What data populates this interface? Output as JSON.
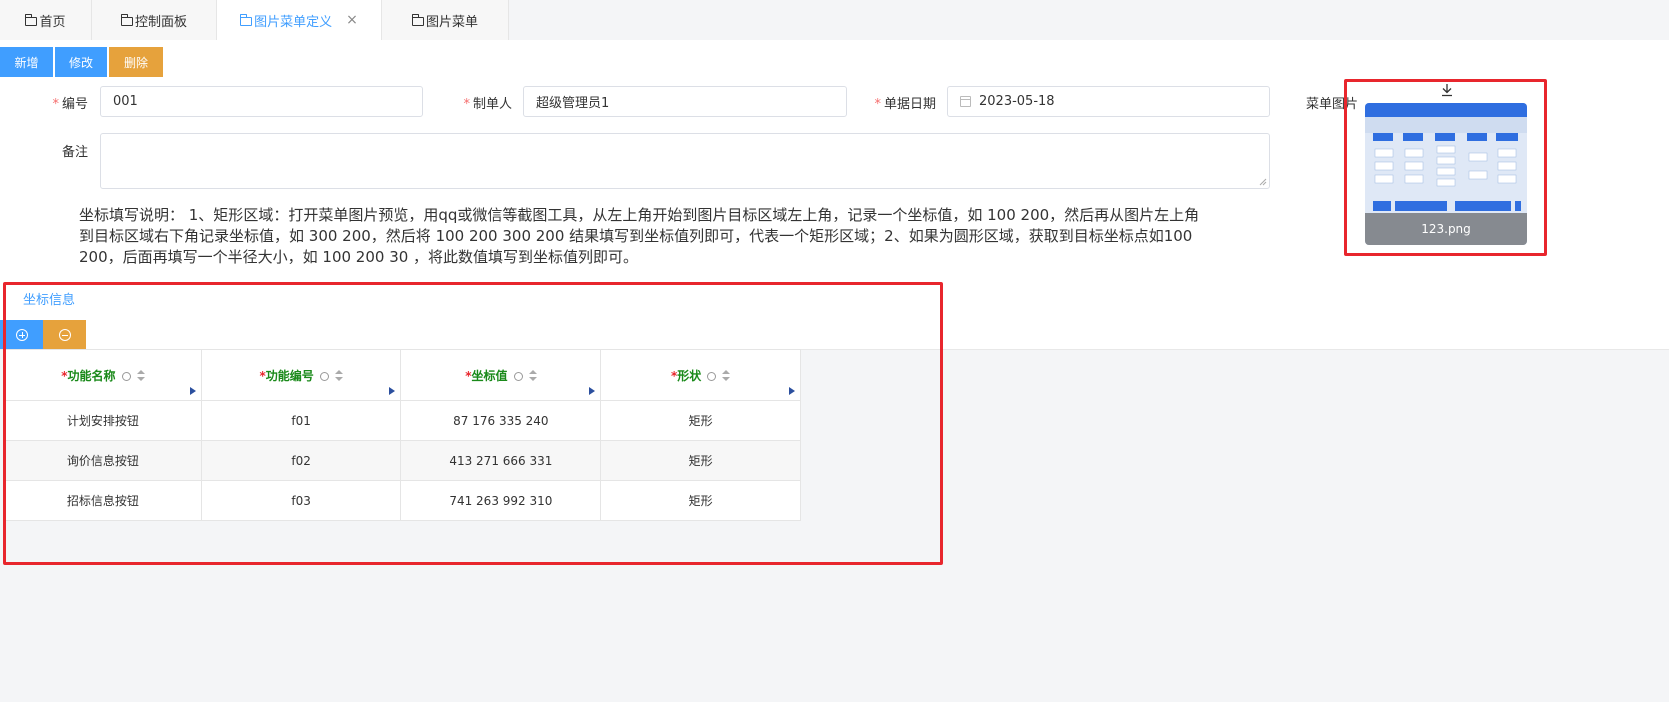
{
  "tabs": [
    {
      "label": "首页"
    },
    {
      "label": "控制面板"
    },
    {
      "label": "图片菜单定义",
      "close": "×"
    },
    {
      "label": "图片菜单"
    }
  ],
  "toolbar": {
    "add": "新增",
    "edit": "修改",
    "delete": "删除"
  },
  "form": {
    "code": {
      "label": "编号",
      "value": "001"
    },
    "creator": {
      "label": "制单人",
      "value": "超级管理员1"
    },
    "date": {
      "label": "单据日期",
      "value": "2023-05-18"
    },
    "image": {
      "label": "菜单图片",
      "filename": "123.png"
    },
    "remark": {
      "label": "备注",
      "value": ""
    }
  },
  "note_lines": [
    "坐标填写说明： 1、矩形区域：打开菜单图片预览，用qq或微信等截图工具，从左上角开始到图片目标区域左上角，记录一个坐标值，如 100 200，然后再从图片左上角",
    "到目标区域右下角记录坐标值，如 300 200，然后将 100 200 300 200 结果填写到坐标值列即可，代表一个矩形区域；2、如果为圆形区域，获取到目标坐标点如100",
    "200，后面再填写一个半径大小，如 100 200 30 ，将此数值填写到坐标值列即可。"
  ],
  "subtab": "坐标信息",
  "table": {
    "headers": [
      "功能名称",
      "功能编号",
      "坐标值",
      "形状"
    ],
    "rows": [
      [
        "计划安排按钮",
        "f01",
        "87 176 335 240",
        "矩形"
      ],
      [
        "询价信息按钮",
        "f02",
        "413 271 666 331",
        "矩形"
      ],
      [
        "招标信息按钮",
        "f03",
        "741 263 992 310",
        "矩形"
      ]
    ]
  },
  "colors": {
    "primary": "#409eff",
    "warning": "#e6a23c",
    "highlight": "#e8262d",
    "header_text": "#1a8a1a"
  }
}
